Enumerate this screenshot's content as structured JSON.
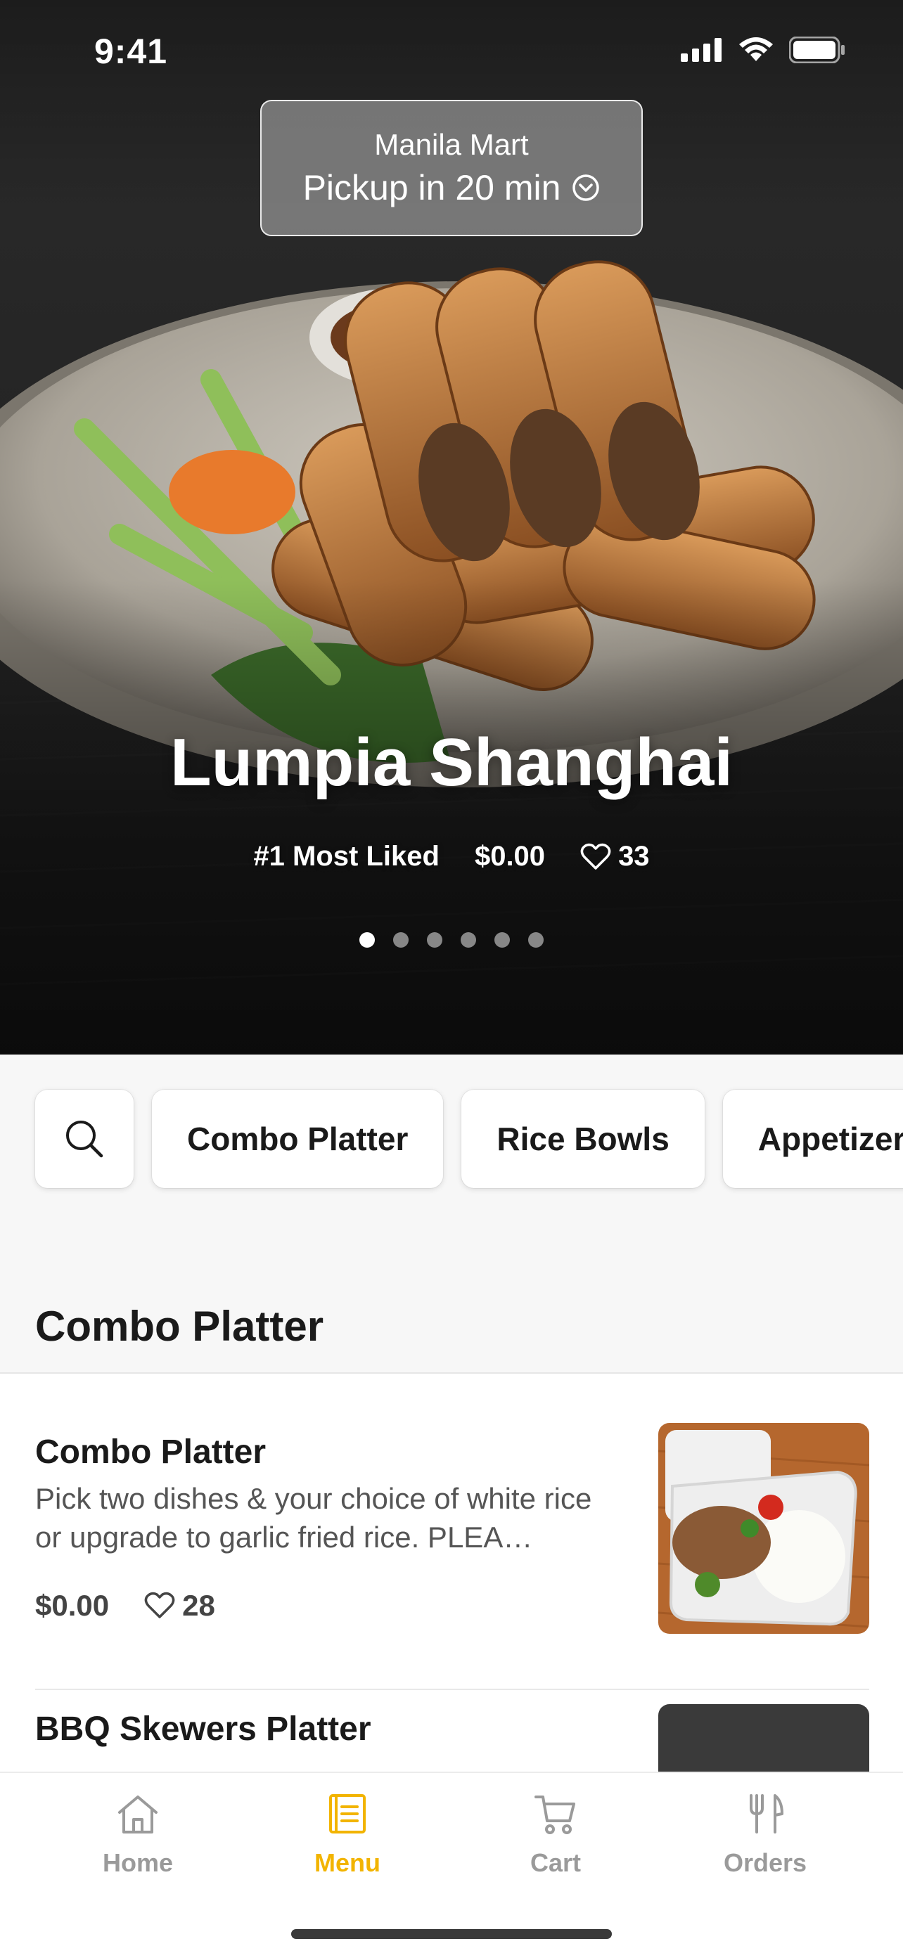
{
  "status_bar": {
    "time": "9:41",
    "icons": [
      "signal-icon",
      "wifi-icon",
      "battery-icon"
    ]
  },
  "store": {
    "name": "Manila Mart",
    "pickup": "Pickup in 20 min",
    "icon": "chevron-circle-down-icon"
  },
  "featured": {
    "title": "Lumpia Shanghai",
    "rank": "#1 Most Liked",
    "price": "$0.00",
    "likes": "33",
    "carousel": {
      "count": 6,
      "active": 1
    }
  },
  "categories": {
    "search_icon": "search-icon",
    "items": [
      "Combo Platter",
      "Rice Bowls",
      "Appetizers"
    ]
  },
  "section": {
    "title": "Combo Platter"
  },
  "menu_items": [
    {
      "name": "Combo Platter",
      "description": "Pick two dishes & your choice of white rice or upgrade to garlic fried rice. PLEA…",
      "price": "$0.00",
      "likes": "28"
    },
    {
      "name": "BBQ Skewers Platter"
    }
  ],
  "tabs": [
    {
      "label": "Home",
      "icon": "home-icon",
      "active": false
    },
    {
      "label": "Menu",
      "icon": "menu-icon",
      "active": true
    },
    {
      "label": "Cart",
      "icon": "cart-icon",
      "active": false
    },
    {
      "label": "Orders",
      "icon": "fork-knife-icon",
      "active": false
    }
  ],
  "colors": {
    "accent": "#f2b400",
    "inactive": "#9a9a9a",
    "text": "#1a1a1a"
  }
}
